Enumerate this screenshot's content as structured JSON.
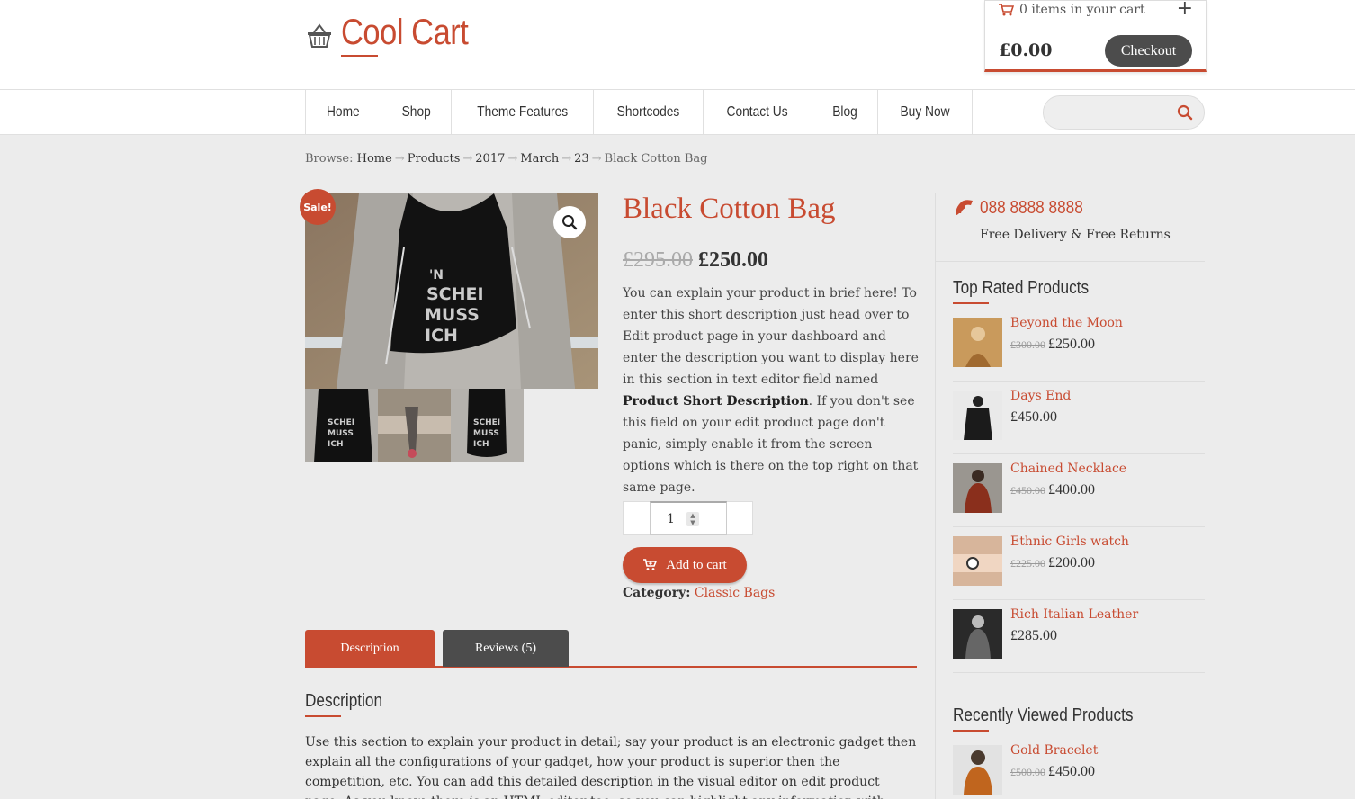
{
  "site": {
    "title": "Cool Cart",
    "accent_color": "#c84b31",
    "dark_button_color": "#4c4c4c"
  },
  "cart": {
    "items_text": "0 items in your cart",
    "total": "£0.00",
    "checkout_label": "Checkout",
    "expand_icon": "plus-icon"
  },
  "nav": {
    "items": [
      {
        "label": "Home"
      },
      {
        "label": "Shop"
      },
      {
        "label": "Theme Features"
      },
      {
        "label": "Shortcodes"
      },
      {
        "label": "Contact Us"
      },
      {
        "label": "Blog"
      },
      {
        "label": "Buy Now"
      }
    ],
    "search_placeholder": ""
  },
  "breadcrumb": {
    "prefix": "Browse:",
    "items": [
      "Home",
      "Products",
      "2017",
      "March",
      "23"
    ],
    "current": "Black Cotton Bag"
  },
  "product": {
    "sale_badge": "Sale!",
    "title": "Black Cotton Bag",
    "old_price": "£295.00",
    "price": "£250.00",
    "short_desc_1": "You can explain your product in brief here! To enter this short description just head over to Edit product page in your dashboard and enter the description you want to display here in this section in text editor field named ",
    "short_desc_bold": "Product Short Description",
    "short_desc_2": ". If you don't see this field on your edit product page don't panic, simply enable it from the screen options which is there on the top right on that same page.",
    "quantity": "1",
    "add_to_cart_label": "Add to cart",
    "category_label": "Category:",
    "category_value": "Classic Bags"
  },
  "tabs": {
    "items": [
      {
        "label": "Description"
      },
      {
        "label": "Reviews (5)"
      }
    ],
    "active": "Description"
  },
  "description": {
    "heading": "Description",
    "text": "Use this section to explain your product in detail; say your product is an electronic gadget then explain all the configurations of your gadget, how your product is superior then the competition, etc. You can add this detailed description in the visual editor on edit product page. As you know, there is an HTML editor too, so you can highlight any information with ..."
  },
  "sidebar": {
    "phone": "088 8888 8888",
    "delivery_text": "Free Delivery & Free Returns",
    "top_rated_title": "Top Rated Products",
    "top_rated": [
      {
        "name": "Beyond the Moon",
        "old_price": "£300.00",
        "price": "£250.00"
      },
      {
        "name": "Days End",
        "old_price": "",
        "price": "£450.00"
      },
      {
        "name": "Chained Necklace",
        "old_price": "£450.00",
        "price": "£400.00"
      },
      {
        "name": "Ethnic Girls watch",
        "old_price": "£225.00",
        "price": "£200.00"
      },
      {
        "name": "Rich Italian Leather",
        "old_price": "",
        "price": "£285.00"
      }
    ],
    "recent_title": "Recently Viewed Products",
    "recent": [
      {
        "name": "Gold Bracelet",
        "old_price": "£500.00",
        "price": "£450.00"
      }
    ]
  }
}
